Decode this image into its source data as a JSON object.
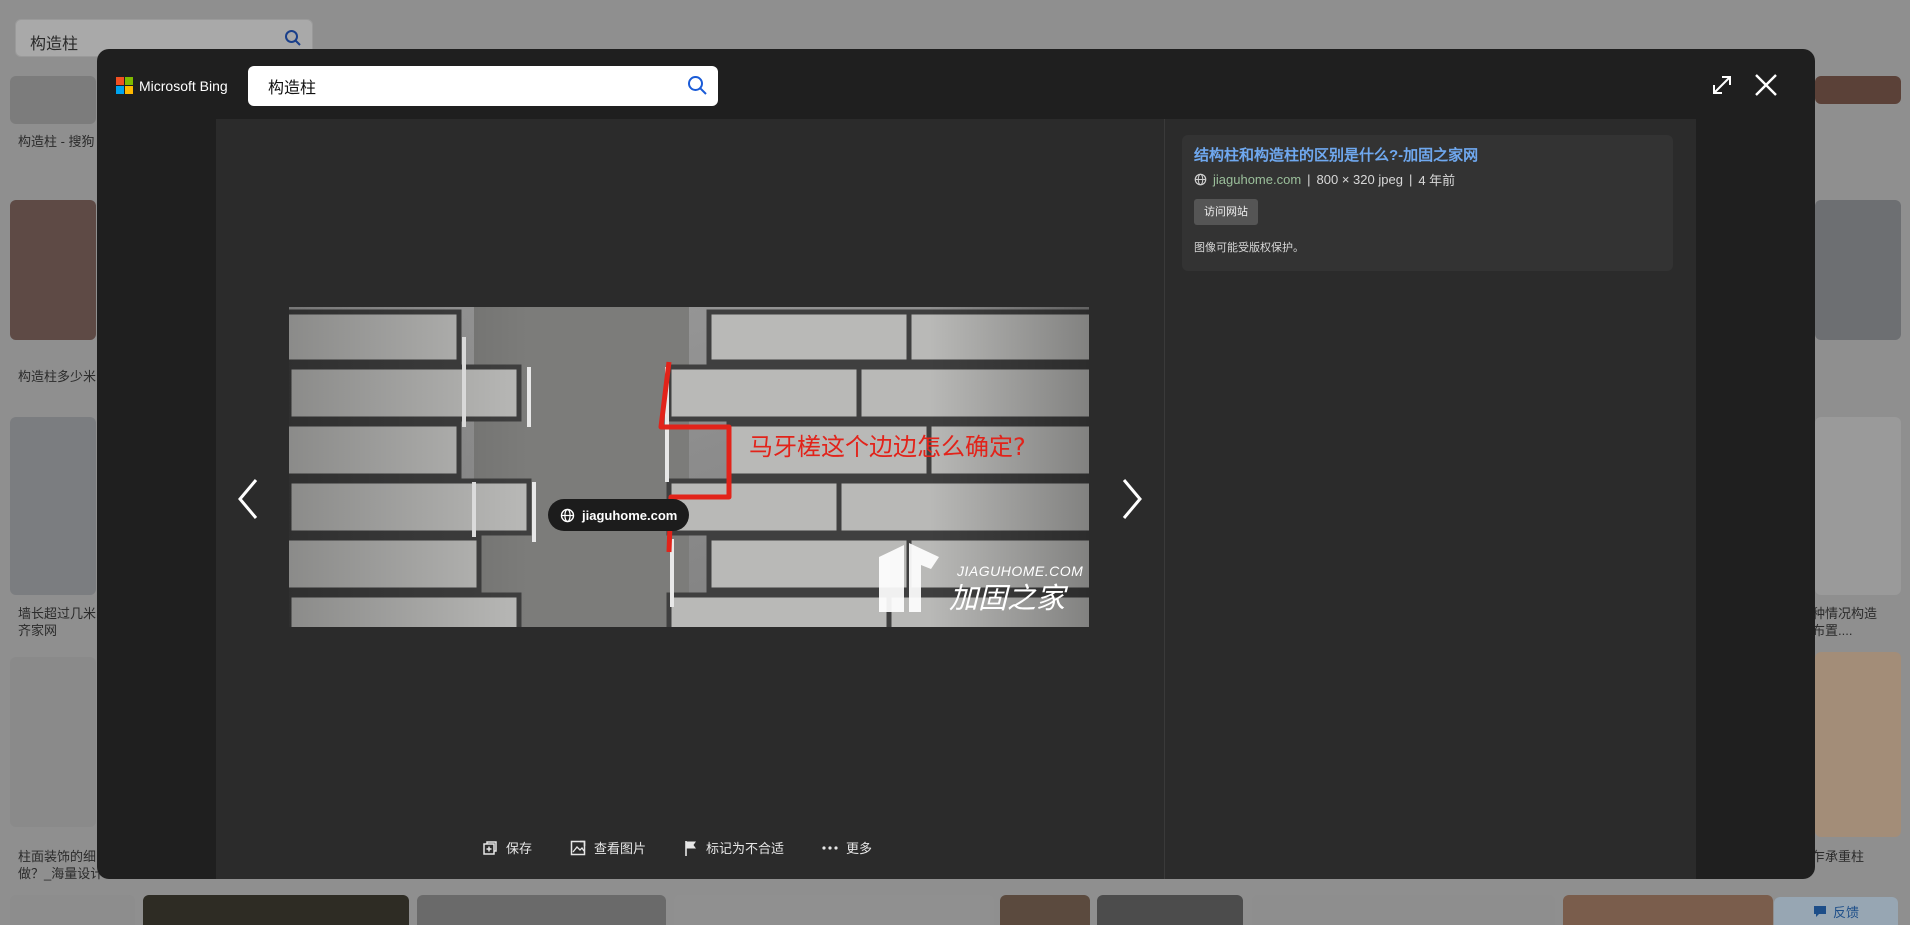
{
  "background": {
    "search_value": "构造柱",
    "captions": [
      "构造柱 - 搜狗",
      "构造柱多少米",
      "墙长超过几米",
      "齐家网",
      "柱面装饰的细",
      "做？_海量设计",
      "种情况构造",
      "布置....",
      "乍承重柱"
    ],
    "feedback_label": "反馈"
  },
  "header": {
    "logo_text": "Microsoft Bing",
    "search_value": "构造柱",
    "logo_colors": [
      "#f25022",
      "#7fba00",
      "#00a4ef",
      "#ffb900"
    ]
  },
  "viewer": {
    "source_pill": "jiaguhome.com",
    "image_annotation": "马牙槎这个边边怎么确定?",
    "watermark_en": "JIAGUHOME.COM",
    "watermark_cn": "加固之家",
    "accent_red": "#e2231a"
  },
  "actions": {
    "save": "保存",
    "view_image": "查看图片",
    "flag": "标记为不合适",
    "more": "更多"
  },
  "info": {
    "title": "结构柱和构造柱的区别是什么?-加固之家网",
    "domain": "jiaguhome.com",
    "separator": "|",
    "dimensions": "800 × 320 jpeg",
    "age": "4 年前",
    "visit_label": "访问网站",
    "copyright_note": "图像可能受版权保护。"
  }
}
